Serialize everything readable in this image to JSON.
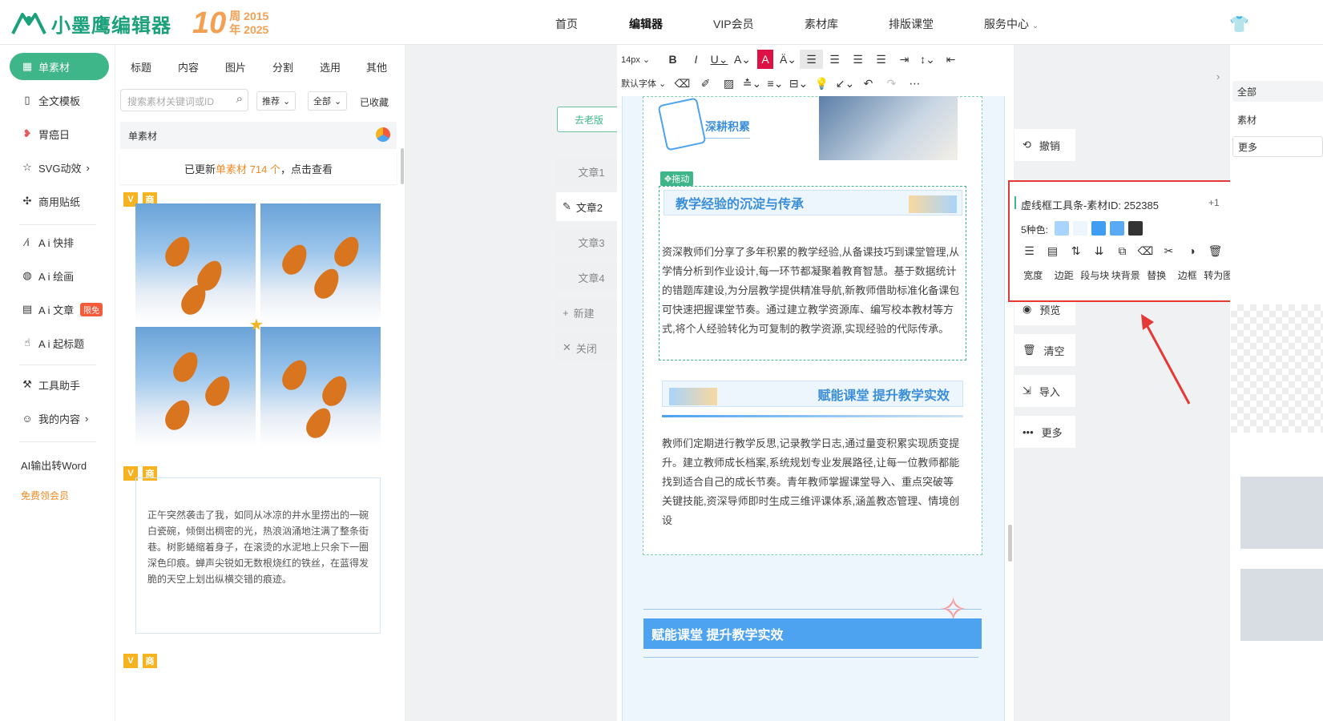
{
  "header": {
    "logo_name": "小墨鹰编辑器",
    "anniv_num": "10",
    "anniv_line1": "周 2015",
    "anniv_line2": "年 2025",
    "nav": [
      "首页",
      "编辑器",
      "VIP会员",
      "素材库",
      "排版课堂",
      "服务中心"
    ]
  },
  "leftnav": {
    "items": [
      {
        "label": "单素材",
        "icon": "grid-icon"
      },
      {
        "label": "全文模板",
        "icon": "template-icon"
      },
      {
        "label": "胃癌日",
        "icon": "ribbon-icon"
      },
      {
        "label": "SVG动效",
        "icon": "star-icon"
      },
      {
        "label": "商用贴纸",
        "icon": "puzzle-icon"
      },
      {
        "label": "A i 快排",
        "icon": "ai-icon"
      },
      {
        "label": "A i 绘画",
        "icon": "palette-icon"
      },
      {
        "label": "A i 文章",
        "icon": "doc-icon",
        "badge": "限免"
      },
      {
        "label": "A i 起标题",
        "icon": "hand-icon"
      },
      {
        "label": "工具助手",
        "icon": "tools-icon"
      },
      {
        "label": "我的内容",
        "icon": "user-icon"
      },
      {
        "label": "AI输出转Word",
        "icon": ""
      },
      {
        "label": "免费领会员",
        "icon": ""
      }
    ]
  },
  "material": {
    "tabs": [
      "标题",
      "内容",
      "图片",
      "分割",
      "选用",
      "其他"
    ],
    "search_placeholder": "搜索素材关键词或ID",
    "filter1": "推荐",
    "filter2": "全部",
    "favorites": "已收藏",
    "header": "单素材",
    "notice_prefix": "已更新",
    "notice_highlight": "单素材 714 个",
    "notice_suffix": "，点击查看",
    "badge_v": "V",
    "badge_shang": "商",
    "card_text": "正午突然袭击了我，如同从冰凉的井水里捞出的一碗白瓷碗，倾倒出稠密的光，热浪汹涌地注满了整条街巷。树影蜷缩着身子，在滚烫的水泥地上只余下一圈深色印痕。蝉声尖锐如无数根烧红的铁丝，在蓝得发脆的天空上划出纵横交错的痕迹。"
  },
  "workspace": {
    "old_version": "去老版",
    "docs": [
      "文章1",
      "文章2",
      "文章3",
      "文章4"
    ],
    "new": "新建",
    "close": "关闭"
  },
  "toolbar": {
    "font_size": "14px",
    "font_family": "默认字体"
  },
  "article": {
    "header_title": "深耕积累",
    "drag_label": "拖动",
    "sec1_title": "教学经验的沉淀与传承",
    "sec1_text": "资深教师们分享了多年积累的教学经验,从备课技巧到课堂管理,从学情分析到作业设计,每一环节都凝聚着教育智慧。基于数据统计的错题库建设,为分层教学提供精准导航,新教师借助标准化备课包可快速把握课堂节奏。通过建立教学资源库、编写校本教材等方式,将个人经验转化为可复制的教学资源,实现经验的代际传承。",
    "sec2_title": "赋能课堂 提升教学实效",
    "sec2_text": "教师们定期进行教学反思,记录教学日志,通过量变积累实现质变提升。建立教师成长档案,系统规划专业发展路径,让每一位教师都能找到适合自己的成长节奏。青年教师掌握课堂导入、重点突破等关键技能,资深导师即时生成三维评课体系,涵盖教态管理、情境创设",
    "sec3_title": "赋能课堂 提升教学实效"
  },
  "side_actions": [
    "撤销",
    "预览",
    "清空",
    "导入",
    "更多"
  ],
  "popup": {
    "title": "虚线框工具条-素材ID: 252385",
    "plus": "+1",
    "colors_label": "5种色:",
    "colors": [
      "#a9d4fb",
      "#eef6fd",
      "#3f9df2",
      "#59a9f5",
      "#333333"
    ],
    "tools": [
      "宽度",
      "边距",
      "段与块",
      "块背景",
      "替换",
      "边框",
      "转为图"
    ]
  },
  "right_panel": {
    "tags": [
      "全部",
      "素材",
      "更多"
    ]
  }
}
